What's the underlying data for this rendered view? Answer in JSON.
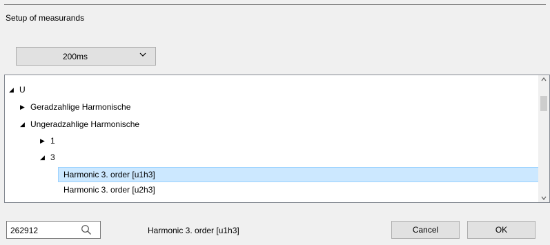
{
  "dialog": {
    "title": "Setup of measurands"
  },
  "interval": {
    "selected": "200ms"
  },
  "tree": {
    "nodes": [
      {
        "arrow": "◢",
        "label": "U",
        "expanded": true
      },
      {
        "arrow": "▶",
        "label": "Geradzahlige Harmonische",
        "expanded": false
      },
      {
        "arrow": "◢",
        "label": "Ungeradzahlige Harmonische",
        "expanded": true
      },
      {
        "arrow": "▶",
        "label": "1",
        "expanded": false
      },
      {
        "arrow": "◢",
        "label": "3",
        "expanded": true
      },
      {
        "arrow": "",
        "label": "Harmonic 3. order [u1h3]",
        "selected": true
      },
      {
        "arrow": "",
        "label": "Harmonic 3. order [u2h3]",
        "selected": false
      }
    ]
  },
  "footer": {
    "search_value": "262912",
    "selected_measurand": "Harmonic 3. order [u1h3]",
    "cancel_label": "Cancel",
    "ok_label": "OK"
  },
  "icons": {
    "dropdown": "chevron-down-icon",
    "search": "magnifier-icon",
    "expanded": "expanded-triangle-icon",
    "collapsed": "collapsed-triangle-icon"
  },
  "colors": {
    "selection_bg": "#cce8ff",
    "selection_border": "#99d1ff",
    "dialog_bg": "#f0f0f0",
    "button_bg": "#e1e1e1"
  }
}
